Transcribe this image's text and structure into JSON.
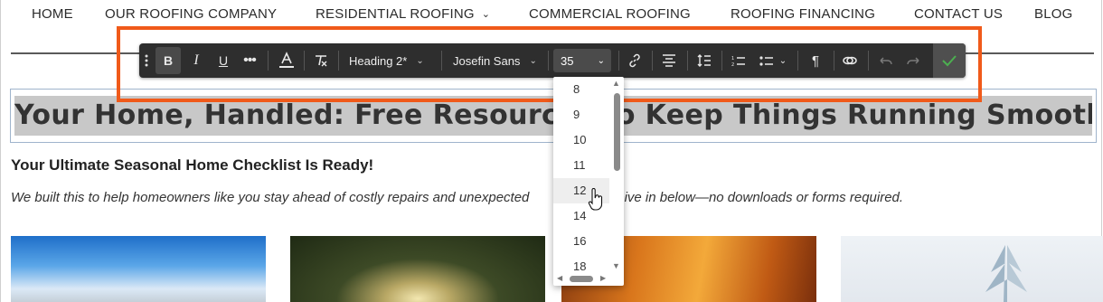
{
  "nav": {
    "items": [
      {
        "label": "HOME"
      },
      {
        "label": "OUR ROOFING COMPANY"
      },
      {
        "label": "RESIDENTIAL ROOFING",
        "has_dropdown": true
      },
      {
        "label": "COMMERCIAL ROOFING"
      },
      {
        "label": "ROOFING FINANCING"
      },
      {
        "label": "CONTACT US"
      },
      {
        "label": "BLOG"
      }
    ]
  },
  "toolbar": {
    "drag_handle_icon": "vertical-dots-icon",
    "bold_icon": "bold-icon",
    "bold_active": true,
    "text_style": "Heading 2*",
    "font_family": "Josefin Sans",
    "font_size": "35",
    "confirm_icon": "checkmark-icon",
    "accent_color": "#4caf50"
  },
  "font_size_dropdown": {
    "options": [
      "8",
      "9",
      "10",
      "11",
      "12",
      "14",
      "16",
      "18"
    ],
    "hovered": "12"
  },
  "page": {
    "heading": "Your Home, Handled: Free Resources to Keep Things Running Smoothly",
    "subheading": "Your Ultimate Seasonal Home Checklist Is Ready!",
    "intro_left": "We built this to help homeowners like you stay ahead of costly repairs and unexpected",
    "intro_right": "Dive in below—no downloads or forms required."
  },
  "colors": {
    "annotation": "#f05a1a",
    "toolbar_bg": "#2e2e2e",
    "heading_highlight": "#c8c8c8"
  }
}
